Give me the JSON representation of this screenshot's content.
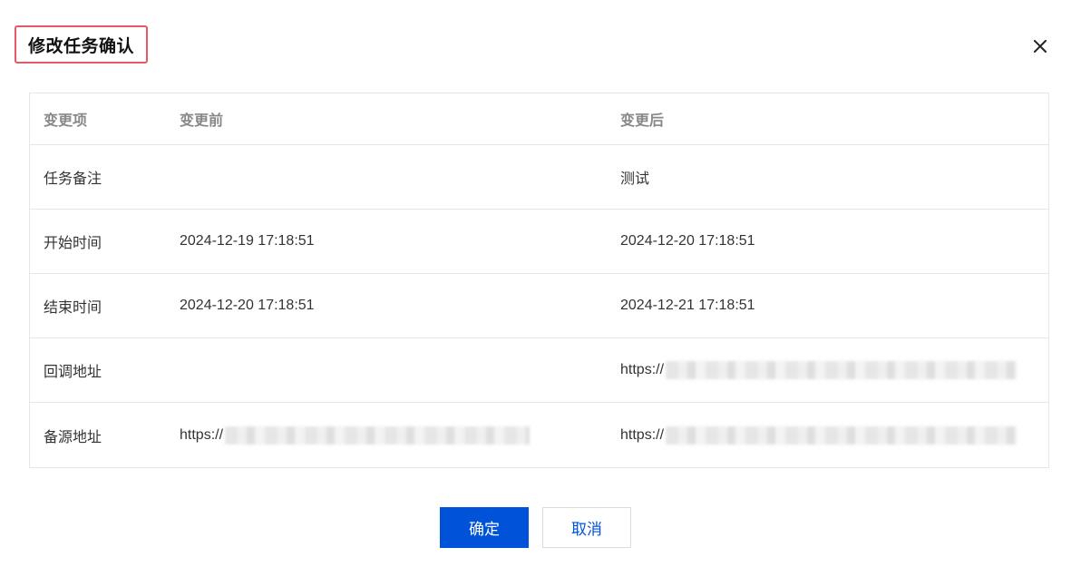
{
  "dialog": {
    "title": "修改任务确认",
    "close_icon": "close-icon"
  },
  "table": {
    "headers": [
      "变更项",
      "变更前",
      "变更后"
    ],
    "rows": [
      {
        "item": "任务备注",
        "before": "",
        "after": "测试"
      },
      {
        "item": "开始时间",
        "before": "2024-12-19 17:18:51",
        "after": "2024-12-20 17:18:51"
      },
      {
        "item": "结束时间",
        "before": "2024-12-20 17:18:51",
        "after": "2024-12-21 17:18:51"
      },
      {
        "item": "回调地址",
        "before": "",
        "after": "https://"
      },
      {
        "item": "备源地址",
        "before": "https://",
        "after": "https://"
      }
    ]
  },
  "footer": {
    "confirm_label": "确定",
    "cancel_label": "取消"
  },
  "colors": {
    "primary": "#0052d9",
    "title_highlight_border": "#e5586a",
    "border": "#e6e6e6"
  }
}
